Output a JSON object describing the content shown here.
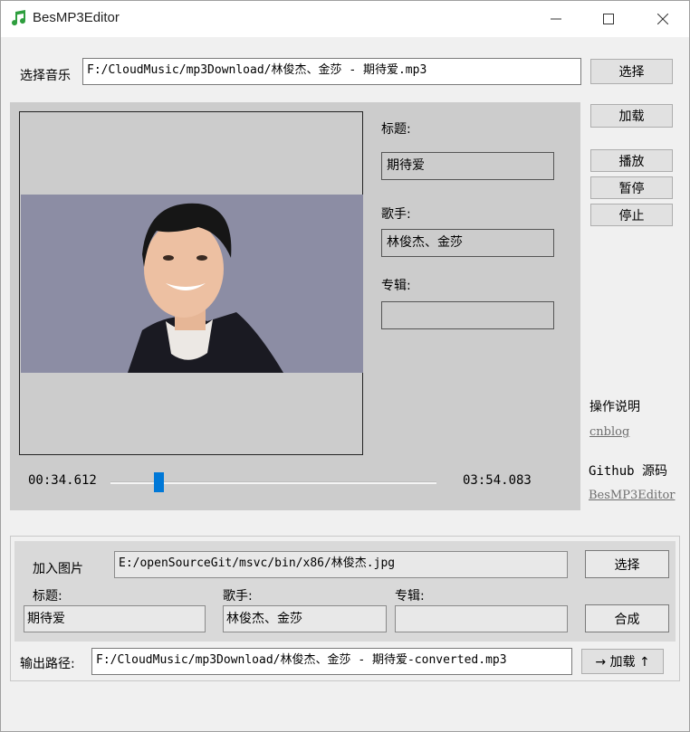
{
  "window": {
    "title": "BesMP3Editor"
  },
  "top": {
    "music_label": "选择音乐",
    "music_path": "F:/CloudMusic/mp3Download/林俊杰、金莎 - 期待爱.mp3",
    "select_button": "选择",
    "load_button": "加载",
    "play_button": "播放",
    "pause_button": "暂停",
    "stop_button": "停止"
  },
  "info": {
    "title_label": "标题:",
    "title_value": "期待爱",
    "artist_label": "歌手:",
    "artist_value": "林俊杰、金莎",
    "album_label": "专辑:",
    "album_value": ""
  },
  "player": {
    "current_time": "00:34.612",
    "total_time": "03:54.083",
    "progress": 0.148
  },
  "side": {
    "help_label": "操作说明",
    "help_link": "cnblog",
    "github_label": "Github 源码",
    "github_link": "BesMP3Editor"
  },
  "bottom": {
    "image_label": "加入图片",
    "image_path": "E:/openSourceGit/msvc/bin/x86/林俊杰.jpg",
    "select_button": "选择",
    "title_label": "标题:",
    "title_value": "期待爱",
    "artist_label": "歌手:",
    "artist_value": "林俊杰、金莎",
    "album_label": "专辑:",
    "album_value": "",
    "compose_button": "合成",
    "output_label": "输出路径:",
    "output_path": "F:/CloudMusic/mp3Download/林俊杰、金莎 - 期待爱-converted.mp3",
    "load_button": "→ 加载 ↑"
  },
  "colors": {
    "accent": "#0078d7",
    "panel": "#cccccc",
    "app_icon": "#2e9e3e"
  }
}
